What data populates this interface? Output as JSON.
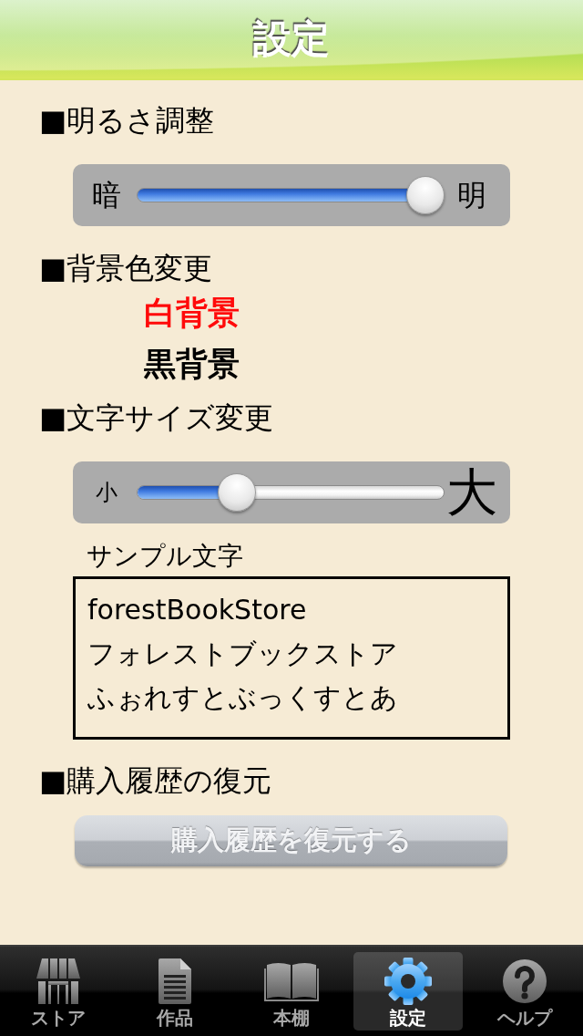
{
  "header": {
    "title": "設定"
  },
  "brightness": {
    "heading": "■明るさ調整",
    "slider": {
      "kind": "uniform",
      "min_label": "暗",
      "max_label": "明",
      "level": 1
    }
  },
  "background_color": {
    "heading": "■背景色変更",
    "options": [
      {
        "label": "白背景",
        "selected": true
      },
      {
        "label": "黒背景",
        "selected": false
      }
    ]
  },
  "text_size": {
    "heading": "■文字サイズ変更",
    "slider": {
      "kind": "graded",
      "min_label": "小",
      "max_label": "大",
      "level": 0.3
    },
    "sample_label": "サンプル文字",
    "sample_lines": [
      "forestBookStore",
      "フォレストブックストア",
      "ふぉれすとぶっくすとあ"
    ]
  },
  "purchase_restore": {
    "heading": "■購入履歴の復元",
    "button": "購入履歴を復元する"
  },
  "tab_bar": [
    {
      "label": "ストア",
      "selected": false
    },
    {
      "label": "作品",
      "selected": false
    },
    {
      "label": "本棚",
      "selected": false
    },
    {
      "label": "設定",
      "selected": true
    },
    {
      "label": "ヘルプ",
      "selected": false
    }
  ]
}
